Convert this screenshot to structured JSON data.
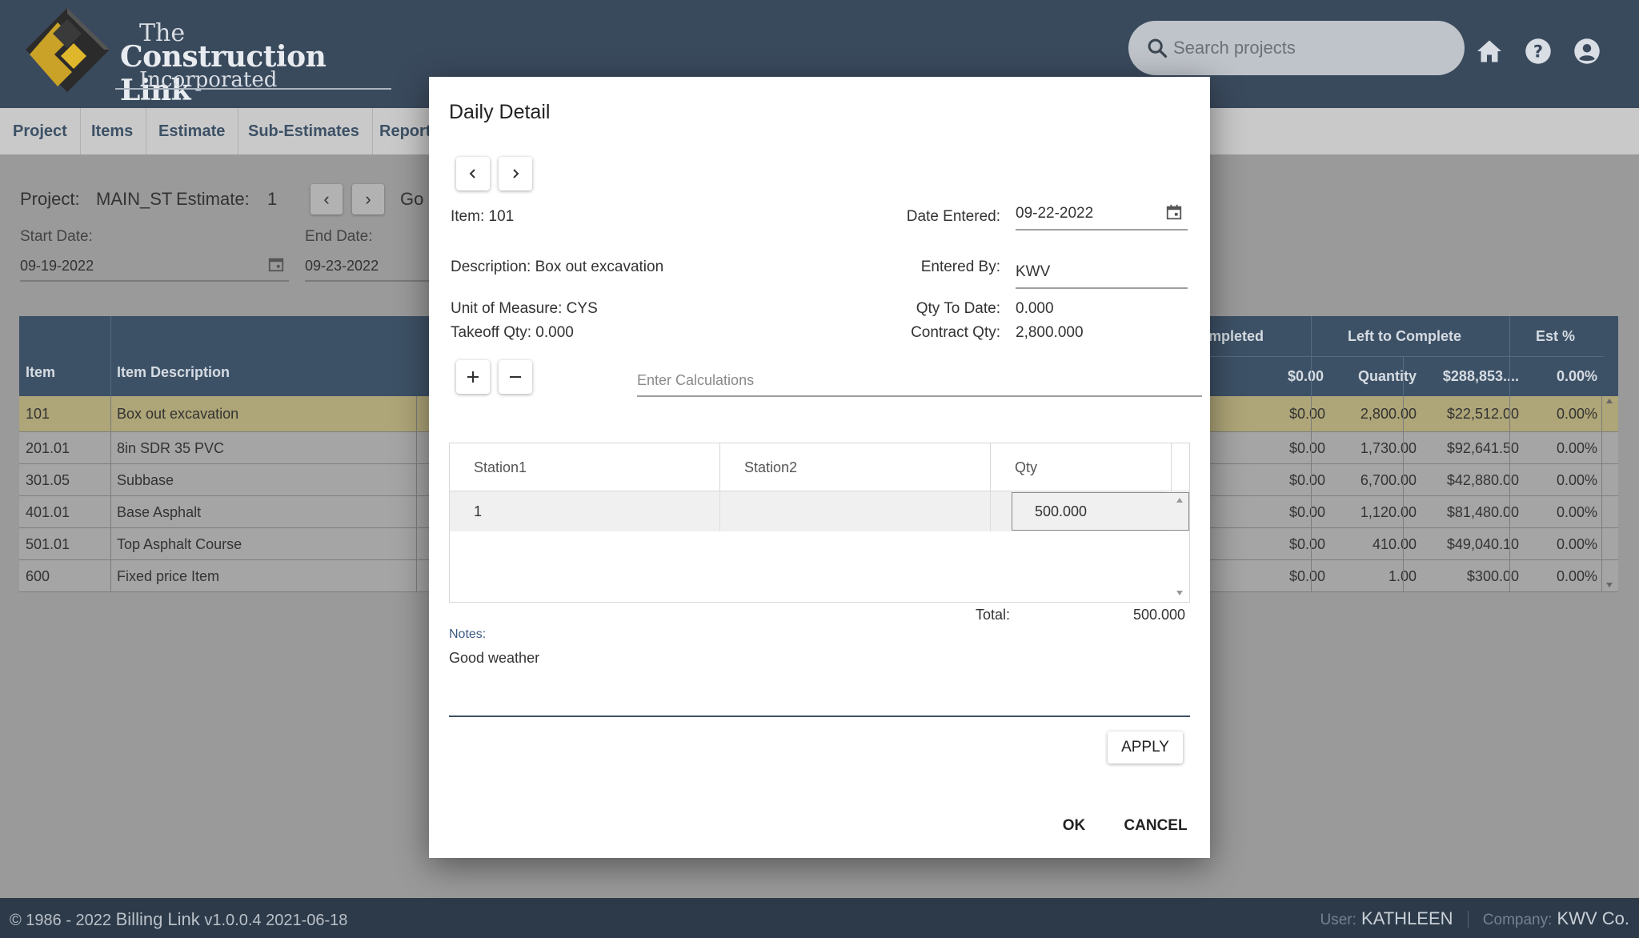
{
  "header": {
    "logo": {
      "line1": "The",
      "line2": "Construction Link",
      "line3": "Incorporated"
    },
    "search_placeholder": "Search projects",
    "icons": [
      "home-icon",
      "help-icon",
      "account-icon"
    ]
  },
  "nav": {
    "items": [
      {
        "label": "Project"
      },
      {
        "label": "Items"
      },
      {
        "label": "Estimate"
      },
      {
        "label": "Sub-Estimates"
      },
      {
        "label": "Report"
      }
    ]
  },
  "controls": {
    "project_label": "Project:",
    "project_value": "MAIN_ST",
    "estimate_label": "Estimate:",
    "estimate_value": "1",
    "goto_label": "Go",
    "start_date_label": "Start Date:",
    "start_date_value": "09-19-2022",
    "end_date_label": "End Date:",
    "end_date_value": "09-23-2022"
  },
  "table": {
    "headers": {
      "item": "Item",
      "item_description": "Item Description",
      "completed": "mpleted",
      "left_to_complete": "Left to Complete",
      "est_pct": "Est %",
      "sub_amount": "$0.00",
      "sub_quantity": "Quantity",
      "sub_left_amount": "$288,853....",
      "sub_est_pct": "0.00%"
    },
    "rows": [
      {
        "item": "101",
        "desc": "Box out excavation",
        "amount": "$0.00",
        "qty": "2,800.00",
        "left_amt": "$22,512.00",
        "pct": "0.00%"
      },
      {
        "item": "201.01",
        "desc": "8in SDR 35 PVC",
        "amount": "$0.00",
        "qty": "1,730.00",
        "left_amt": "$92,641.50",
        "pct": "0.00%"
      },
      {
        "item": "301.05",
        "desc": "Subbase",
        "amount": "$0.00",
        "qty": "6,700.00",
        "left_amt": "$42,880.00",
        "pct": "0.00%"
      },
      {
        "item": "401.01",
        "desc": "Base Asphalt",
        "amount": "$0.00",
        "qty": "1,120.00",
        "left_amt": "$81,480.00",
        "pct": "0.00%"
      },
      {
        "item": "501.01",
        "desc": "Top Asphalt Course",
        "amount": "$0.00",
        "qty": "410.00",
        "left_amt": "$49,040.10",
        "pct": "0.00%"
      },
      {
        "item": "600",
        "desc": "Fixed price Item",
        "amount": "$0.00",
        "qty": "1.00",
        "left_amt": "$300.00",
        "pct": "0.00%"
      }
    ]
  },
  "footer": {
    "copyright": "© 1986 - 2022",
    "app_name": "Billing Link",
    "version": "v1.0.0.4 2021-06-18",
    "user_label": "User:",
    "user_value": "KATHLEEN",
    "company_label": "Company:",
    "company_value": "KWV Co."
  },
  "dialog": {
    "title": "Daily Detail",
    "item": "Item: 101",
    "description": "Description: Box out excavation",
    "unit_of_measure": "Unit of Measure: CYS",
    "takeoff_qty": "Takeoff Qty: 0.000",
    "date_entered_label": "Date Entered:",
    "date_entered_value": "09-22-2022",
    "entered_by_label": "Entered By:",
    "entered_by_value": "KWV",
    "qty_to_date_label": "Qty To Date:",
    "qty_to_date_value": "0.000",
    "contract_qty_label": "Contract Qty:",
    "contract_qty_value": "2,800.000",
    "calc_placeholder": "Enter Calculations",
    "grid": {
      "columns": [
        "Station1",
        "Station2",
        "Qty"
      ],
      "rows": [
        {
          "station1": "1",
          "station2": "",
          "qty": "500.000"
        }
      ],
      "total_label": "Total:",
      "total_value": "500.000"
    },
    "notes_label": "Notes:",
    "notes_value": "Good weather",
    "apply_label": "APPLY",
    "ok_label": "OK",
    "cancel_label": "CANCEL"
  }
}
